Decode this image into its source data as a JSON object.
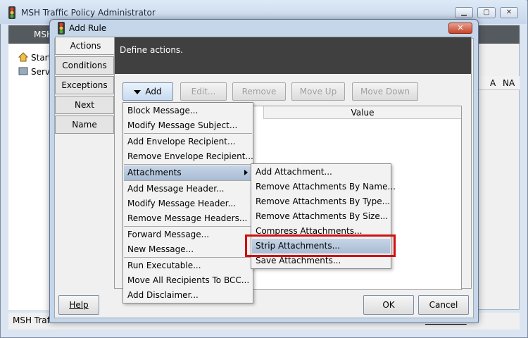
{
  "main_window": {
    "title": "MSH Traffic Policy Administrator",
    "tab_label": "MSH",
    "tree_items": [
      "Start",
      "Serv"
    ],
    "table_headers": [
      "A",
      "NA"
    ],
    "status_left": "MSH Traffic",
    "status_right": "ware.com"
  },
  "dialog": {
    "title": "Add Rule",
    "close_label": "✕",
    "side_tabs": [
      "Actions",
      "Conditions",
      "Exceptions",
      "Next",
      "Name"
    ],
    "header_text": "Define actions.",
    "toolbar": {
      "add": "Add",
      "edit": "Edit...",
      "remove": "Remove",
      "move_up": "Move Up",
      "move_down": "Move Down"
    },
    "table_value_header": "Value",
    "help_button": "Help",
    "ok_button": "OK",
    "cancel_button": "Cancel"
  },
  "add_menu": {
    "items": [
      "Block Message...",
      "Modify Message Subject...",
      "Add Envelope Recipient...",
      "Remove Envelope Recipient...",
      "Attachments",
      "Add Message Header...",
      "Modify Message Header...",
      "Remove Message Headers...",
      "Forward Message...",
      "New Message...",
      "Run Executable...",
      "Move All Recipients To BCC...",
      "Add Disclaimer..."
    ]
  },
  "attachments_submenu": {
    "items": [
      "Add Attachment...",
      "Remove Attachments By Name...",
      "Remove Attachments By Type...",
      "Remove Attachments By Size...",
      "Compress Attachments...",
      "Strip Attachments...",
      "Save Attachments..."
    ]
  },
  "colors": {
    "highlight_box": "#d01010",
    "menu_highlight": "#b4c6dc",
    "header_dark": "#404040"
  }
}
